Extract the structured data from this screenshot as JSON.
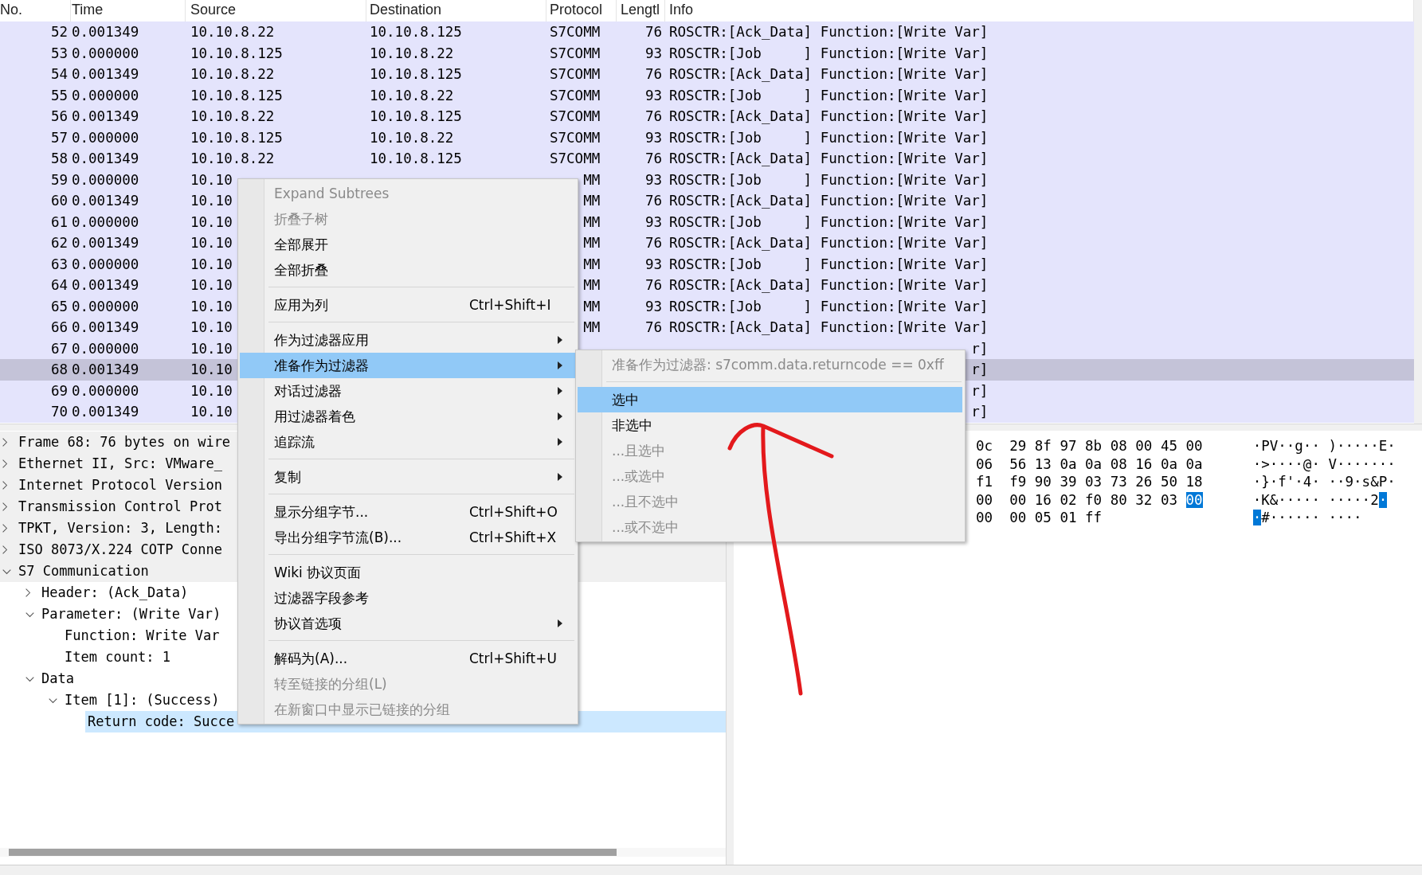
{
  "packet_list": {
    "columns": [
      "No.",
      "Time",
      "Source",
      "Destination",
      "Protocol",
      "Lengtl",
      "Info"
    ],
    "rows": [
      {
        "no": "52",
        "time": "0.001349",
        "source": "10.10.8.22",
        "destination": "10.10.8.125",
        "protocol": "S7COMM",
        "length": "76",
        "info": "ROSCTR:[Ack_Data] Function:[Write Var]",
        "selected": false
      },
      {
        "no": "53",
        "time": "0.000000",
        "source": "10.10.8.125",
        "destination": "10.10.8.22",
        "protocol": "S7COMM",
        "length": "93",
        "info": "ROSCTR:[Job     ] Function:[Write Var]",
        "selected": false
      },
      {
        "no": "54",
        "time": "0.001349",
        "source": "10.10.8.22",
        "destination": "10.10.8.125",
        "protocol": "S7COMM",
        "length": "76",
        "info": "ROSCTR:[Ack_Data] Function:[Write Var]",
        "selected": false
      },
      {
        "no": "55",
        "time": "0.000000",
        "source": "10.10.8.125",
        "destination": "10.10.8.22",
        "protocol": "S7COMM",
        "length": "93",
        "info": "ROSCTR:[Job     ] Function:[Write Var]",
        "selected": false
      },
      {
        "no": "56",
        "time": "0.001349",
        "source": "10.10.8.22",
        "destination": "10.10.8.125",
        "protocol": "S7COMM",
        "length": "76",
        "info": "ROSCTR:[Ack_Data] Function:[Write Var]",
        "selected": false
      },
      {
        "no": "57",
        "time": "0.000000",
        "source": "10.10.8.125",
        "destination": "10.10.8.22",
        "protocol": "S7COMM",
        "length": "93",
        "info": "ROSCTR:[Job     ] Function:[Write Var]",
        "selected": false
      },
      {
        "no": "58",
        "time": "0.001349",
        "source": "10.10.8.22",
        "destination": "10.10.8.125",
        "protocol": "S7COMM",
        "length": "76",
        "info": "ROSCTR:[Ack_Data] Function:[Write Var]",
        "selected": false
      },
      {
        "no": "59",
        "time": "0.000000",
        "source": "10.10",
        "protocol": "MM",
        "length": "93",
        "info": "ROSCTR:[Job     ] Function:[Write Var]",
        "selected": false
      },
      {
        "no": "60",
        "time": "0.001349",
        "source": "10.10",
        "protocol": "MM",
        "length": "76",
        "info": "ROSCTR:[Ack_Data] Function:[Write Var]",
        "selected": false
      },
      {
        "no": "61",
        "time": "0.000000",
        "source": "10.10",
        "protocol": "MM",
        "length": "93",
        "info": "ROSCTR:[Job     ] Function:[Write Var]",
        "selected": false
      },
      {
        "no": "62",
        "time": "0.001349",
        "source": "10.10",
        "protocol": "MM",
        "length": "76",
        "info": "ROSCTR:[Ack_Data] Function:[Write Var]",
        "selected": false
      },
      {
        "no": "63",
        "time": "0.000000",
        "source": "10.10",
        "protocol": "MM",
        "length": "93",
        "info": "ROSCTR:[Job     ] Function:[Write Var]",
        "selected": false
      },
      {
        "no": "64",
        "time": "0.001349",
        "source": "10.10",
        "protocol": "MM",
        "length": "76",
        "info": "ROSCTR:[Ack_Data] Function:[Write Var]",
        "selected": false
      },
      {
        "no": "65",
        "time": "0.000000",
        "source": "10.10",
        "protocol": "MM",
        "length": "93",
        "info": "ROSCTR:[Job     ] Function:[Write Var]",
        "selected": false
      },
      {
        "no": "66",
        "time": "0.001349",
        "source": "10.10",
        "protocol": "MM",
        "length": "76",
        "info": "ROSCTR:[Ack_Data] Function:[Write Var]",
        "selected": false
      },
      {
        "no": "67",
        "time": "0.000000",
        "source": "10.10",
        "info": "r]",
        "selected": false
      },
      {
        "no": "68",
        "time": "0.001349",
        "source": "10.10",
        "info": "r]",
        "selected": true
      },
      {
        "no": "69",
        "time": "0.000000",
        "source": "10.10",
        "info": "r]",
        "selected": false
      },
      {
        "no": "70",
        "time": "0.001349",
        "source": "10.10",
        "info": "r]",
        "selected": false
      }
    ]
  },
  "detail_tree": [
    {
      "label": "Frame 68: 76 bytes on wire",
      "expanded": false,
      "selected": false
    },
    {
      "label": "Ethernet II, Src: VMware_",
      "expanded": false,
      "selected": false
    },
    {
      "label": "Internet Protocol Version",
      "expanded": false,
      "selected": false
    },
    {
      "label": "Transmission Control Prot",
      "expanded": false,
      "selected": false
    },
    {
      "label": "TPKT, Version: 3, Length:",
      "expanded": false,
      "selected": false
    },
    {
      "label": "ISO 8073/X.224 COTP Conne",
      "expanded": false,
      "selected": false
    },
    {
      "label": "S7 Communication",
      "expanded": true,
      "selected": false,
      "children": [
        {
          "label": "Header: (Ack_Data)",
          "expanded": false,
          "selected": false
        },
        {
          "label": "Parameter: (Write Var)",
          "expanded": true,
          "selected": false,
          "children": [
            {
              "label": "Function: Write Var",
              "selected": false
            },
            {
              "label": "Item count: 1",
              "selected": false
            }
          ]
        },
        {
          "label": "Data",
          "expanded": true,
          "selected": false,
          "children": [
            {
              "label": "Item [1]: (Success)",
              "expanded": true,
              "selected": false,
              "children": [
                {
                  "label": "Return code: Succe",
                  "selected": true
                }
              ]
            }
          ]
        }
      ]
    }
  ],
  "hex_rows": [
    {
      "bytes": [
        {
          "text": "0c",
          "selected": false
        },
        {
          "text": "29",
          "selected": false
        },
        {
          "text": "8f",
          "selected": false
        },
        {
          "text": "97",
          "selected": false
        },
        {
          "text": "8b",
          "selected": false
        },
        {
          "text": "08",
          "selected": false
        },
        {
          "text": "00",
          "selected": false
        },
        {
          "text": "45",
          "selected": false
        },
        {
          "text": "00",
          "selected": false
        }
      ],
      "ascii": [
        {
          "text": "·PV··g·· )·····E·",
          "selected": false
        }
      ]
    },
    {
      "bytes": [
        {
          "text": "06",
          "selected": false
        },
        {
          "text": "56",
          "selected": false
        },
        {
          "text": "13",
          "selected": false
        },
        {
          "text": "0a",
          "selected": false
        },
        {
          "text": "0a",
          "selected": false
        },
        {
          "text": "08",
          "selected": false
        },
        {
          "text": "16",
          "selected": false
        },
        {
          "text": "0a",
          "selected": false
        },
        {
          "text": "0a",
          "selected": false
        }
      ],
      "ascii": [
        {
          "text": "·>····@· V·······",
          "selected": false
        }
      ]
    },
    {
      "bytes": [
        {
          "text": "f1",
          "selected": false
        },
        {
          "text": "f9",
          "selected": false
        },
        {
          "text": "90",
          "selected": false
        },
        {
          "text": "39",
          "selected": false
        },
        {
          "text": "03",
          "selected": false
        },
        {
          "text": "73",
          "selected": false
        },
        {
          "text": "26",
          "selected": false
        },
        {
          "text": "50",
          "selected": false
        },
        {
          "text": "18",
          "selected": false
        }
      ],
      "ascii": [
        {
          "text": "·}·f'·4· ··9·s&P·",
          "selected": false
        }
      ]
    },
    {
      "bytes": [
        {
          "text": "00",
          "selected": false
        },
        {
          "text": "00",
          "selected": false
        },
        {
          "text": "16",
          "selected": false
        },
        {
          "text": "02",
          "selected": false
        },
        {
          "text": "f0",
          "selected": false
        },
        {
          "text": "80",
          "selected": false
        },
        {
          "text": "32",
          "selected": false
        },
        {
          "text": "03",
          "selected": false
        },
        {
          "text": "00",
          "selected": true
        }
      ],
      "ascii": [
        {
          "text": "·K&····· ·····2",
          "selected": false
        },
        {
          "text": "·",
          "selected": true
        }
      ]
    },
    {
      "bytes": [
        {
          "text": "00",
          "selected": false
        },
        {
          "text": "00",
          "selected": false
        },
        {
          "text": "05",
          "selected": false
        },
        {
          "text": "01",
          "selected": false
        },
        {
          "text": "ff",
          "selected": false
        }
      ],
      "ascii": [
        {
          "text": "·",
          "selected": true
        },
        {
          "text": "#······ ····",
          "selected": false
        }
      ]
    }
  ],
  "context_menu": {
    "items": [
      {
        "kind": "item",
        "label": "Expand Subtrees",
        "disabled": true,
        "selected": false,
        "has_submenu": false
      },
      {
        "kind": "item",
        "label": "折叠子树",
        "disabled": true,
        "selected": false,
        "has_submenu": false
      },
      {
        "kind": "item",
        "label": "全部展开",
        "disabled": false,
        "selected": false,
        "has_submenu": false
      },
      {
        "kind": "item",
        "label": "全部折叠",
        "disabled": false,
        "selected": false,
        "has_submenu": false
      },
      {
        "kind": "separator"
      },
      {
        "kind": "item",
        "label": "应用为列",
        "shortcut": "Ctrl+Shift+I",
        "disabled": false,
        "selected": false,
        "has_submenu": false
      },
      {
        "kind": "separator"
      },
      {
        "kind": "item",
        "label": "作为过滤器应用",
        "disabled": false,
        "selected": false,
        "has_submenu": true
      },
      {
        "kind": "item",
        "label": "准备作为过滤器",
        "disabled": false,
        "selected": true,
        "has_submenu": true
      },
      {
        "kind": "item",
        "label": "对话过滤器",
        "disabled": false,
        "selected": false,
        "has_submenu": true
      },
      {
        "kind": "item",
        "label": "用过滤器着色",
        "disabled": false,
        "selected": false,
        "has_submenu": true
      },
      {
        "kind": "item",
        "label": "追踪流",
        "disabled": false,
        "selected": false,
        "has_submenu": true
      },
      {
        "kind": "separator"
      },
      {
        "kind": "item",
        "label": "复制",
        "disabled": false,
        "selected": false,
        "has_submenu": true
      },
      {
        "kind": "separator"
      },
      {
        "kind": "item",
        "label": "显示分组字节...",
        "shortcut": "Ctrl+Shift+O",
        "disabled": false,
        "selected": false,
        "has_submenu": false
      },
      {
        "kind": "item",
        "label": "导出分组字节流(B)...",
        "shortcut": "Ctrl+Shift+X",
        "disabled": false,
        "selected": false,
        "has_submenu": false
      },
      {
        "kind": "separator"
      },
      {
        "kind": "item",
        "label": "Wiki 协议页面",
        "disabled": false,
        "selected": false,
        "has_submenu": false
      },
      {
        "kind": "item",
        "label": "过滤器字段参考",
        "disabled": false,
        "selected": false,
        "has_submenu": false
      },
      {
        "kind": "item",
        "label": "协议首选项",
        "disabled": false,
        "selected": false,
        "has_submenu": true
      },
      {
        "kind": "separator"
      },
      {
        "kind": "item",
        "label": "解码为(A)...",
        "shortcut": "Ctrl+Shift+U",
        "disabled": false,
        "selected": false,
        "has_submenu": false
      },
      {
        "kind": "item",
        "label": "转至链接的分组(L)",
        "disabled": true,
        "selected": false,
        "has_submenu": false
      },
      {
        "kind": "item",
        "label": "在新窗口中显示已链接的分组",
        "disabled": true,
        "selected": false,
        "has_submenu": false
      }
    ]
  },
  "submenu": {
    "header": "准备作为过滤器: s7comm.data.returncode == 0xff",
    "items": [
      {
        "label": "选中",
        "disabled": false,
        "selected": true
      },
      {
        "label": "非选中",
        "disabled": false,
        "selected": false
      },
      {
        "label": "...且选中",
        "disabled": true,
        "selected": false
      },
      {
        "label": "...或选中",
        "disabled": true,
        "selected": false
      },
      {
        "label": "...且不选中",
        "disabled": true,
        "selected": false
      },
      {
        "label": "...或不选中",
        "disabled": true,
        "selected": false
      }
    ]
  }
}
